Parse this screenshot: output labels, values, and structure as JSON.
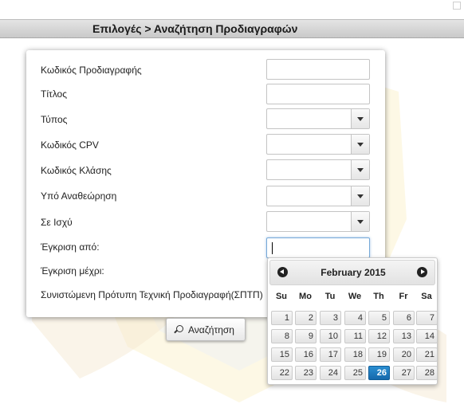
{
  "header": {
    "breadcrumb": "Επιλογές > Αναζήτηση Προδιαγραφών"
  },
  "form": {
    "fields": [
      {
        "label": "Κωδικός Προδιαγραφής",
        "type": "text",
        "value": ""
      },
      {
        "label": "Τίτλος",
        "type": "text",
        "value": ""
      },
      {
        "label": "Τύπος",
        "type": "select",
        "value": ""
      },
      {
        "label": "Κωδικός CPV",
        "type": "select",
        "value": ""
      },
      {
        "label": "Κωδικός Κλάσης",
        "type": "select",
        "value": ""
      },
      {
        "label": "Υπό Αναθεώρηση",
        "type": "select",
        "value": ""
      },
      {
        "label": "Σε Ισχύ",
        "type": "select",
        "value": ""
      },
      {
        "label": "Έγκριση από:",
        "type": "date",
        "value": ""
      },
      {
        "label": "Έγκριση μέχρι:",
        "type": "date",
        "value": ""
      },
      {
        "label": "Συνιστώμενη Πρότυπη Τεχνική Προδιαγραφή(ΣΠΤΠ)",
        "type": "checkbox",
        "value": ""
      }
    ],
    "search_button": "Αναζήτηση"
  },
  "calendar": {
    "month_label": "February 2015",
    "weekdays": [
      "Su",
      "Mo",
      "Tu",
      "We",
      "Th",
      "Fr",
      "Sa"
    ],
    "weeks": [
      [
        "1",
        "2",
        "3",
        "4",
        "5",
        "6",
        "7"
      ],
      [
        "8",
        "9",
        "10",
        "11",
        "12",
        "13",
        "14"
      ],
      [
        "15",
        "16",
        "17",
        "18",
        "19",
        "20",
        "21"
      ],
      [
        "22",
        "23",
        "24",
        "25",
        "26",
        "27",
        "28"
      ]
    ],
    "selected_day": "26"
  },
  "colors": {
    "accent": "#1a7fc4",
    "titlebar": "#d4d4d4",
    "emblem": "#e8c23a"
  }
}
